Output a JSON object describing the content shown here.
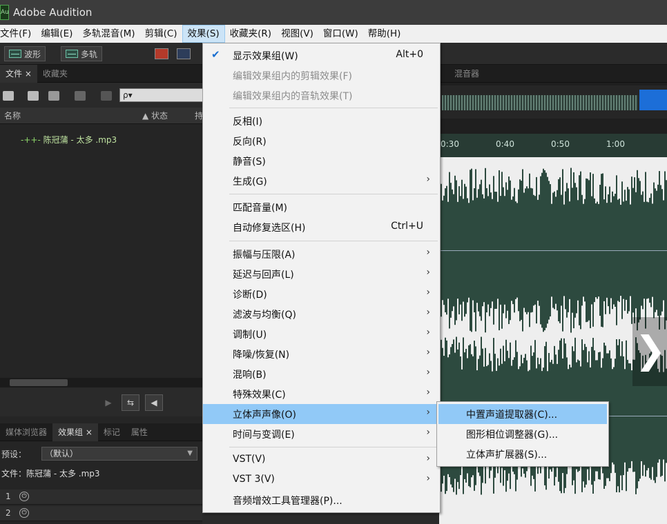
{
  "window": {
    "title": "Adobe Audition",
    "app_icon": "Au"
  },
  "menubar": [
    "文件(F)",
    "编辑(E)",
    "多轨混音(M)",
    "剪辑(C)",
    "效果(S)",
    "收藏夹(R)",
    "视图(V)",
    "窗口(W)",
    "帮助(H)"
  ],
  "toolbar": {
    "waveform_label": "波形",
    "multitrack_label": "多轨"
  },
  "files_panel": {
    "tabs": [
      "文件 ×",
      "收藏夹"
    ],
    "search_placeholder": "ρ▾",
    "columns": {
      "name": "名称",
      "status": "▲ 状态",
      "extra": "持"
    },
    "file_item": "陈冠蒲 - 太多 .mp3"
  },
  "effects_panel": {
    "tabs": [
      "媒体浏览器",
      "效果组 ×",
      "标记",
      "属性"
    ],
    "preset_label": "预设：",
    "preset_value": "（默认）",
    "file_label": "文件：陈冠蒲 - 太多 .mp3",
    "rack": [
      "1",
      "2"
    ]
  },
  "editor": {
    "tab": "混音器",
    "ticks": [
      "0:30",
      "0:40",
      "0:50",
      "1:00"
    ]
  },
  "effects_menu": {
    "items": [
      {
        "label": "显示效果组(W)",
        "shortcut": "Alt+0",
        "checked": true
      },
      {
        "label": "编辑效果组内的剪辑效果(F)",
        "disabled": true
      },
      {
        "label": "编辑效果组内的音轨效果(T)",
        "disabled": true
      },
      {
        "label": "反相(I)"
      },
      {
        "label": "反向(R)"
      },
      {
        "label": "静音(S)"
      },
      {
        "label": "生成(G)",
        "submenu": true
      },
      {
        "label": "匹配音量(M)"
      },
      {
        "label": "自动修复选区(H)",
        "shortcut": "Ctrl+U"
      },
      {
        "label": "振幅与压限(A)",
        "submenu": true
      },
      {
        "label": "延迟与回声(L)",
        "submenu": true
      },
      {
        "label": "诊断(D)",
        "submenu": true
      },
      {
        "label": "滤波与均衡(Q)",
        "submenu": true
      },
      {
        "label": "调制(U)",
        "submenu": true
      },
      {
        "label": "降噪/恢复(N)",
        "submenu": true
      },
      {
        "label": "混响(B)",
        "submenu": true
      },
      {
        "label": "特殊效果(C)",
        "submenu": true
      },
      {
        "label": "立体声声像(O)",
        "submenu": true,
        "highlighted": true
      },
      {
        "label": "时间与变调(E)",
        "submenu": true
      },
      {
        "label": "VST(V)",
        "submenu": true
      },
      {
        "label": "VST 3(V)",
        "submenu": true
      },
      {
        "label": "音频增效工具管理器(P)..."
      }
    ]
  },
  "stereo_submenu": {
    "items": [
      "中置声道提取器(C)...",
      "图形相位调整器(G)...",
      "立体声扩展器(S)..."
    ]
  },
  "glyphs": {
    "check": "✔",
    "arrow": "›",
    "next": "❯",
    "power": "⏻",
    "play": "▶",
    "dropdown": "▼"
  },
  "colors": {
    "menu_highlight": "#91c9f7",
    "waveform": "#2d4a3f",
    "timeline": "#283b34"
  }
}
